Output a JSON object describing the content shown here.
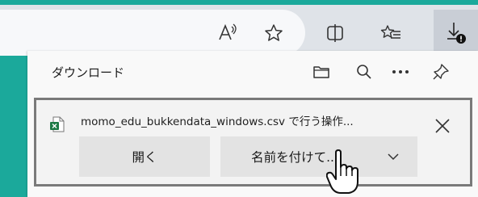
{
  "toolbar": {
    "read_aloud_icon": "read-aloud-icon",
    "favorite_icon": "star-icon",
    "split_icon": "split-screen-icon",
    "favorites_icon": "favorites-list-icon",
    "download_icon": "download-icon"
  },
  "panel": {
    "title": "ダウンロード",
    "icons": [
      "folder-icon",
      "search-icon",
      "more-icon",
      "pin-icon"
    ],
    "item": {
      "filename": "momo_edu_bukkendata_windows.csv で行う操作...",
      "open_label": "開く",
      "save_as_label": "名前を付けて...",
      "file_icon": "csv-file-icon",
      "close_icon": "close-icon",
      "dropdown_icon": "chevron-down-icon"
    }
  }
}
